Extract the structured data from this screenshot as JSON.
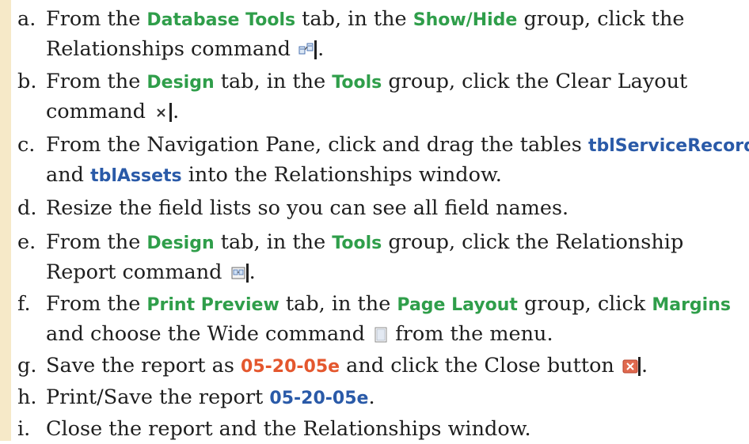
{
  "steps": [
    {
      "letter": "a.",
      "p1": "From the ",
      "k1": "Database Tools",
      "p2": " tab, in the ",
      "k2": "Show/Hide",
      "p3": " group, click the",
      "line2": "Relationships command",
      "icon": "relationships-icon"
    },
    {
      "letter": "b.",
      "p1": "From the ",
      "k1": "Design",
      "p2": " tab, in the ",
      "k2": "Tools",
      "p3": " group, click the Clear Layout",
      "line2": "command",
      "icon": "clear-layout-icon"
    },
    {
      "letter": "c.",
      "p1": "From the Navigation Pane, click and drag the tables ",
      "k1": "tblServiceRecords",
      "line2_k": "tblAssets",
      "line2": " into the Relationships window.",
      "line2_pre": "and "
    },
    {
      "letter": "d.",
      "text": "Resize the field lists so you can see all field names."
    },
    {
      "letter": "e.",
      "p1": "From the ",
      "k1": "Design",
      "p2": " tab, in the ",
      "k2": "Tools",
      "p3": " group, click the Relationship",
      "line2": "Report command",
      "icon": "relationship-report-icon"
    },
    {
      "letter": "f.",
      "p1": "From the ",
      "k1": "Print Preview",
      "p2": " tab, in the ",
      "k2": "Page Layout",
      "p3": " group, click ",
      "k3": "Margins",
      "line2": "and choose the Wide command",
      "line2_post": " from the menu.",
      "icon": "wide-margins-icon"
    },
    {
      "letter": "g.",
      "p1": "Save the report as ",
      "k1": "05-20-05e",
      "p2": " and click the Close button",
      "icon": "close-icon"
    },
    {
      "letter": "h.",
      "p1": "Print/Save the report ",
      "k1": "05-20-05e",
      "p2": "."
    },
    {
      "letter": "i.",
      "text": "Close the report and the Relationships window."
    }
  ],
  "colors": {
    "keyword_green": "#2f9e4a",
    "keyword_blue": "#2a5aa8",
    "filename_red": "#e4572e",
    "sidebar": "#f6e9c8"
  }
}
